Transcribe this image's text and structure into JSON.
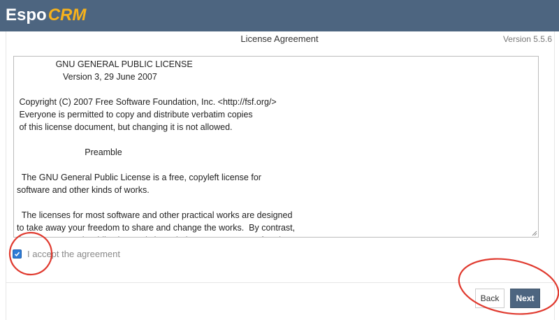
{
  "app": {
    "logo_main": "Espo",
    "logo_accent": "CRM"
  },
  "header": {
    "title": "License Agreement",
    "version": "Version 5.5.6"
  },
  "license": {
    "text": "                GNU GENERAL PUBLIC LICENSE\n                   Version 3, 29 June 2007\n\n Copyright (C) 2007 Free Software Foundation, Inc. <http://fsf.org/>\n Everyone is permitted to copy and distribute verbatim copies\n of this license document, but changing it is not allowed.\n\n                            Preamble\n\n  The GNU General Public License is a free, copyleft license for\nsoftware and other kinds of works.\n\n  The licenses for most software and other practical works are designed\nto take away your freedom to share and change the works.  By contrast,\nthe GNU General Public License is intended to guarantee your freedom to\nshare and change all versions of a program--to make sure it remains free"
  },
  "accept": {
    "label": "I accept the agreement",
    "checked": true
  },
  "buttons": {
    "back": "Back",
    "next": "Next"
  },
  "colors": {
    "topbar": "#4d6580",
    "accent": "#f6b21c",
    "primary_button": "#4d6580",
    "annotation": "#e03a2f",
    "checkbox": "#2d7cd6"
  }
}
